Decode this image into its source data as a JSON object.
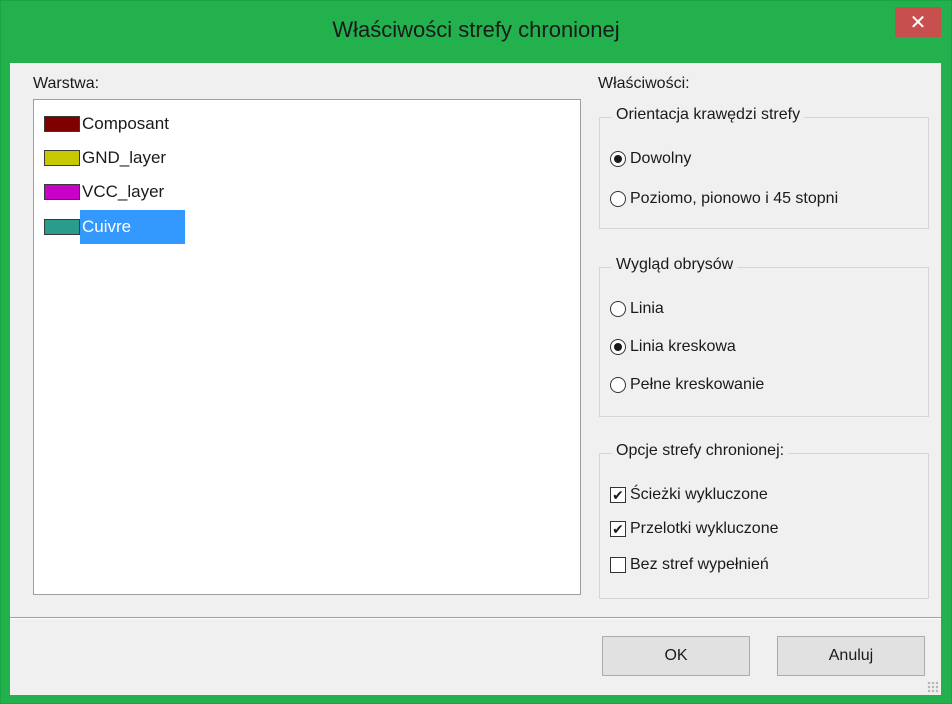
{
  "window": {
    "title": "Właściwości strefy chronionej",
    "close_label": "✕"
  },
  "layers_panel": {
    "label": "Warstwa:",
    "items": [
      {
        "name": "Composant",
        "color": "#800000",
        "selected": false
      },
      {
        "name": "GND_layer",
        "color": "#c8c800",
        "selected": false
      },
      {
        "name": "VCC_layer",
        "color": "#c800c8",
        "selected": false
      },
      {
        "name": "Cuivre",
        "color": "#2a9c8c",
        "selected": true
      }
    ]
  },
  "properties": {
    "label": "Właściwości:",
    "orientation": {
      "title": "Orientacja krawędzi strefy",
      "options": [
        {
          "label": "Dowolny",
          "selected": true
        },
        {
          "label": "Poziomo, pionowo i 45 stopni",
          "selected": false
        }
      ]
    },
    "outline": {
      "title": "Wygląd obrysów",
      "options": [
        {
          "label": "Linia",
          "selected": false
        },
        {
          "label": "Linia kreskowa",
          "selected": true
        },
        {
          "label": "Pełne kreskowanie",
          "selected": false
        }
      ]
    },
    "keepout": {
      "title": "Opcje strefy chronionej:",
      "options": [
        {
          "label": "Ścieżki wykluczone",
          "checked": true
        },
        {
          "label": "Przelotki wykluczone",
          "checked": true
        },
        {
          "label": "Bez stref wypełnień",
          "checked": false
        }
      ]
    }
  },
  "buttons": {
    "ok": "OK",
    "cancel": "Anuluj"
  },
  "colors": {
    "title_bar": "#22b14c",
    "close_button": "#c7504e",
    "selection": "#3399ff"
  }
}
